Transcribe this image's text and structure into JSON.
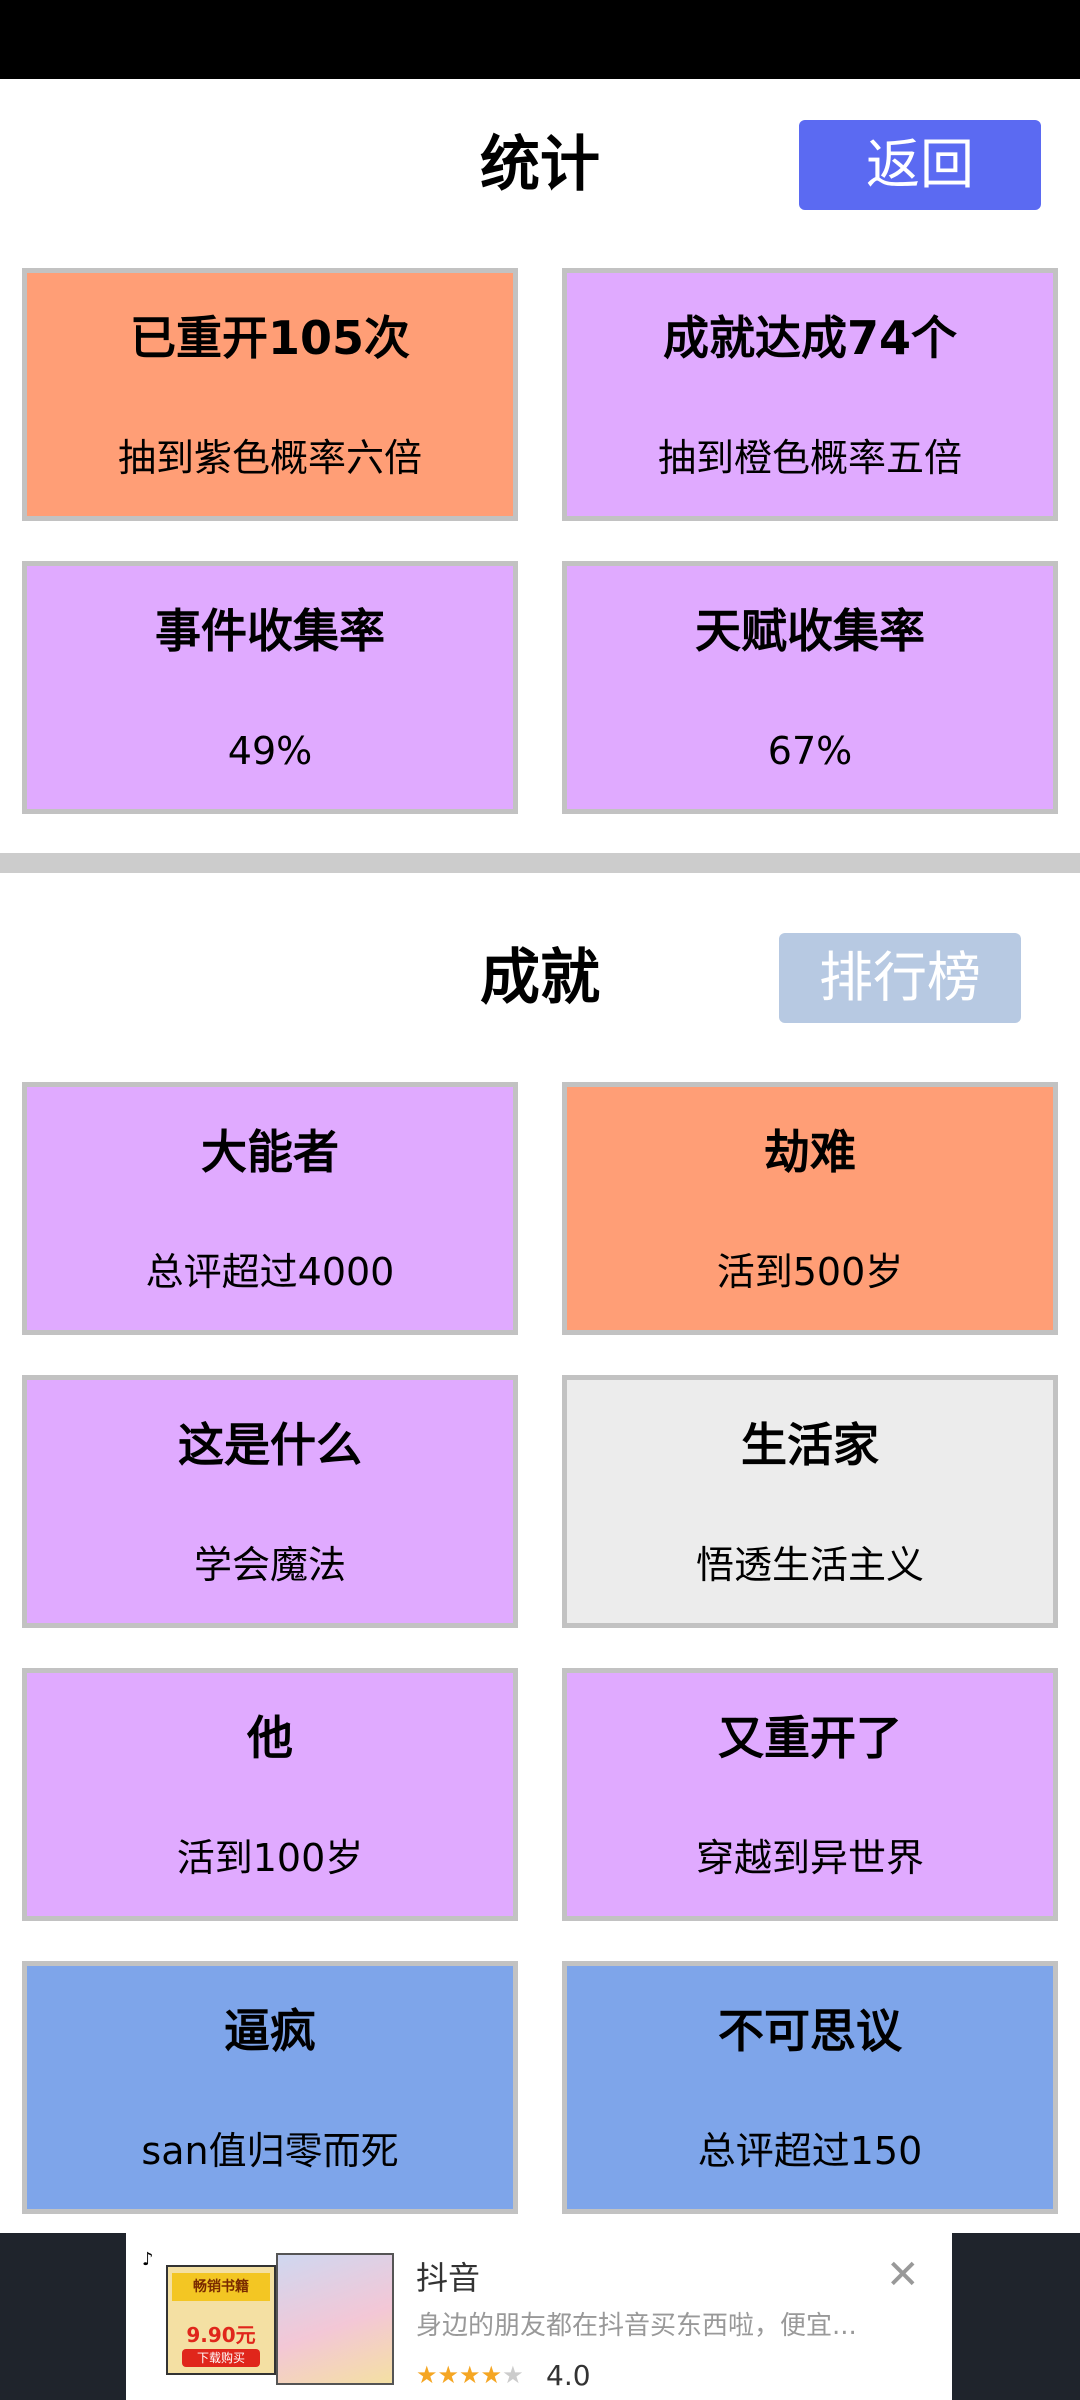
{
  "colors": {
    "orange": "#ff9e76",
    "purple": "#e0aaff",
    "gray": "#ececec",
    "blue": "#7ea5ea",
    "back_button": "#5b6af2",
    "leaderboard_button": "#b7c9e2"
  },
  "stats": {
    "title": "统计",
    "back_label": "返回",
    "cards": [
      {
        "title": "已重开105次",
        "sub": "抽到紫色概率六倍",
        "color": "orange"
      },
      {
        "title": "成就达成74个",
        "sub": "抽到橙色概率五倍",
        "color": "purple"
      },
      {
        "title": "事件收集率",
        "sub": "49%",
        "color": "purple"
      },
      {
        "title": "天赋收集率",
        "sub": "67%",
        "color": "purple"
      }
    ]
  },
  "achievements": {
    "title": "成就",
    "leaderboard_label": "排行榜",
    "cards": [
      {
        "title": "大能者",
        "sub": "总评超过4000",
        "color": "purple"
      },
      {
        "title": "劫难",
        "sub": "活到500岁",
        "color": "orange"
      },
      {
        "title": "这是什么",
        "sub": "学会魔法",
        "color": "purple"
      },
      {
        "title": "生活家",
        "sub": "悟透生活主义",
        "color": "gray"
      },
      {
        "title": "他",
        "sub": "活到100岁",
        "color": "purple"
      },
      {
        "title": "又重开了",
        "sub": "穿越到异世界",
        "color": "purple"
      },
      {
        "title": "逼疯",
        "sub": "san值归零而死",
        "color": "blue"
      },
      {
        "title": "不可思议",
        "sub": "总评超过150",
        "color": "blue"
      }
    ]
  },
  "ad": {
    "app_name": "抖音",
    "description": "身边的朋友都在抖音买东西啦，便宜...",
    "rating": "4.0",
    "rating_stars": 4,
    "sign_text": "畅销书籍",
    "price": "9.90元",
    "buy_text": "下载购买",
    "close_icon": "close-icon"
  }
}
